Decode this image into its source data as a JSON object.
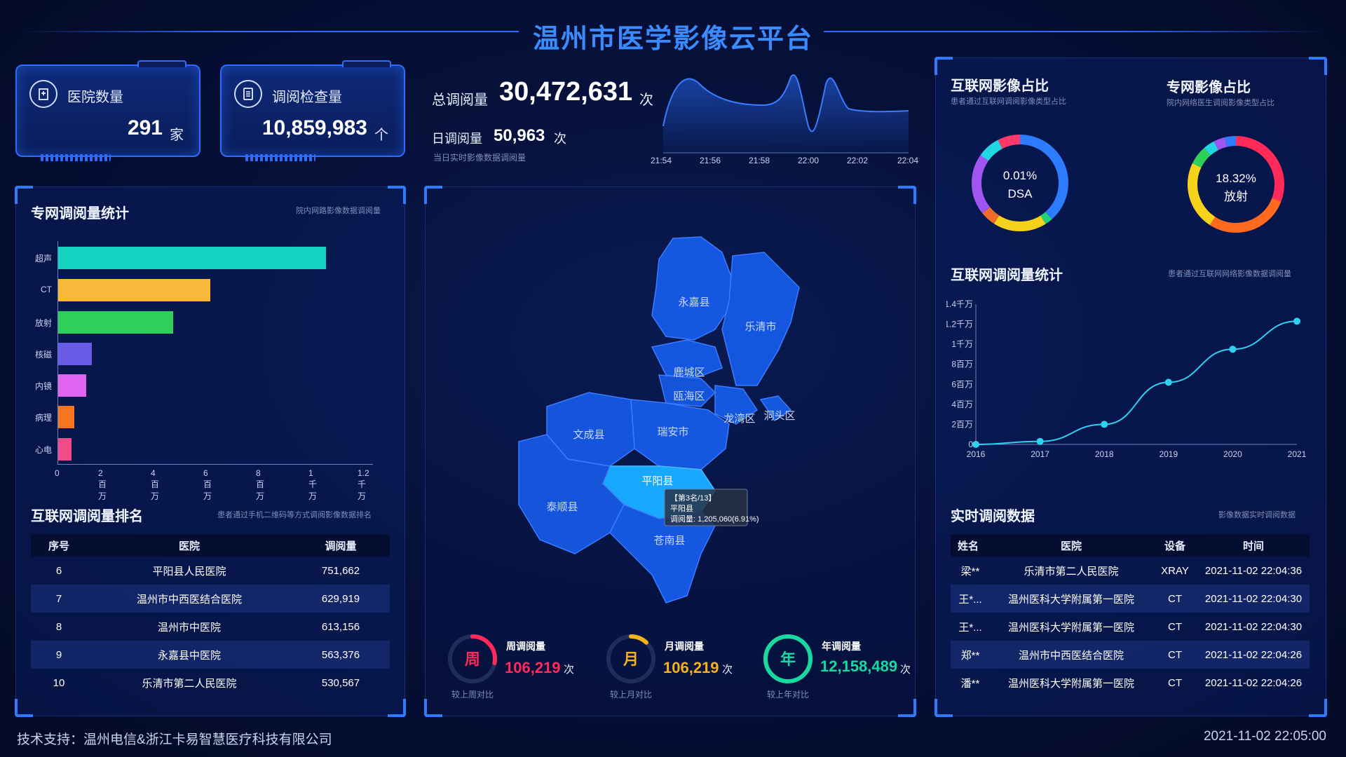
{
  "header": {
    "title": "温州市医学影像云平台"
  },
  "cards": [
    {
      "icon": "hospital-icon",
      "label": "医院数量",
      "value": "291",
      "unit": "家"
    },
    {
      "icon": "document-icon",
      "label": "调阅检查量",
      "value": "10,859,983",
      "unit": "个"
    }
  ],
  "totals": {
    "total_label": "总调阅量",
    "total_value": "30,472,631",
    "total_unit": "次",
    "daily_label": "日调阅量",
    "daily_value": "50,963",
    "daily_unit": "次",
    "note": "当日实时影像数据调阅量",
    "spark_times": [
      "21:54",
      "21:56",
      "21:58",
      "22:00",
      "22:02",
      "22:04"
    ]
  },
  "private_stats": {
    "title": "专网调阅量统计",
    "subtitle": "院内网路影像数据调阅量",
    "chart_data": {
      "type": "bar",
      "categories": [
        "超声",
        "CT",
        "放射",
        "核磁",
        "内镜",
        "病理",
        "心电"
      ],
      "values": [
        10200000,
        5800000,
        4400000,
        1300000,
        1100000,
        650000,
        520000
      ],
      "colors": [
        "#14d2c0",
        "#f7b93a",
        "#2fd05a",
        "#6a5ae8",
        "#e066f2",
        "#f5761f",
        "#f24b8a"
      ],
      "xlim": [
        0,
        12000000
      ],
      "xticks": [
        "0",
        "2百万",
        "4百万",
        "6百万",
        "8百万",
        "1千万",
        "1.2千万"
      ]
    }
  },
  "internet_ranking": {
    "title": "互联网调阅量排名",
    "subtitle": "患者通过手机二维码等方式调阅影像数据排名",
    "columns": [
      "序号",
      "医院",
      "调阅量"
    ],
    "rows": [
      [
        "6",
        "平阳县人民医院",
        "751,662"
      ],
      [
        "7",
        "温州市中西医结合医院",
        "629,919"
      ],
      [
        "8",
        "温州市中医院",
        "613,156"
      ],
      [
        "9",
        "永嘉县中医院",
        "563,376"
      ],
      [
        "10",
        "乐清市第二人民医院",
        "530,567"
      ]
    ]
  },
  "map": {
    "regions": [
      "永嘉县",
      "乐清市",
      "鹿城区",
      "瓯海区",
      "龙湾区",
      "洞头区",
      "瑞安市",
      "文成县",
      "平阳县",
      "泰顺县",
      "苍南县"
    ],
    "tooltip": {
      "rank": "【第3名/13】",
      "name": "平阳县",
      "value": "调阅量: 1,205,060(6.91%)"
    }
  },
  "period_stats": [
    {
      "badge": "周",
      "title": "周调阅量",
      "value": "106,219",
      "unit": "次",
      "sub": "较上周对比",
      "color": "#ff2a5a",
      "fraction": 0.28
    },
    {
      "badge": "月",
      "title": "月调阅量",
      "value": "106,219",
      "unit": "次",
      "sub": "较上月对比",
      "color": "#f5b21a",
      "fraction": 0.12
    },
    {
      "badge": "年",
      "title": "年调阅量",
      "value": "12,158,489",
      "unit": "次",
      "sub": "较上年对比",
      "color": "#18d9a0",
      "fraction": 1.0
    }
  ],
  "internet_ratio": {
    "title": "互联网影像占比",
    "subtitle": "患者通过互联网调阅影像类型占比",
    "center_value": "0.01%",
    "center_label": "DSA"
  },
  "private_ratio": {
    "title": "专网影像占比",
    "subtitle": "院内网络医生调阅影像类型占比",
    "center_value": "18.32%",
    "center_label": "放射"
  },
  "internet_trend": {
    "title": "互联网调阅量统计",
    "subtitle": "患者通过互联网网络影像数据调阅量",
    "chart_data": {
      "type": "line",
      "x": [
        "2016",
        "2017",
        "2018",
        "2019",
        "2020",
        "2021"
      ],
      "values": [
        0,
        300000,
        2000000,
        6200000,
        9500000,
        12300000
      ],
      "ylim": [
        0,
        14000000
      ],
      "yticks": [
        "0",
        "2百万",
        "4百万",
        "6百万",
        "8百万",
        "1千万",
        "1.2千万",
        "1.4千万"
      ],
      "color": "#2fd0f0"
    }
  },
  "realtime": {
    "title": "实时调阅数据",
    "subtitle": "影像数据实时调阅数据",
    "columns": [
      "姓名",
      "医院",
      "设备",
      "时间"
    ],
    "rows": [
      [
        "梁**",
        "乐清市第二人民医院",
        "XRAY",
        "2021-11-02 22:04:36"
      ],
      [
        "王*...",
        "温州医科大学附属第一医院",
        "CT",
        "2021-11-02 22:04:30"
      ],
      [
        "王*...",
        "温州医科大学附属第一医院",
        "CT",
        "2021-11-02 22:04:30"
      ],
      [
        "郑**",
        "温州市中西医结合医院",
        "CT",
        "2021-11-02 22:04:26"
      ],
      [
        "潘**",
        "温州医科大学附属第一医院",
        "CT",
        "2021-11-02 22:04:26"
      ]
    ]
  },
  "footer": {
    "support": "技术支持：温州电信&浙江卡易智慧医疗科技有限公司",
    "clock": "2021-11-02 22:05:00"
  }
}
